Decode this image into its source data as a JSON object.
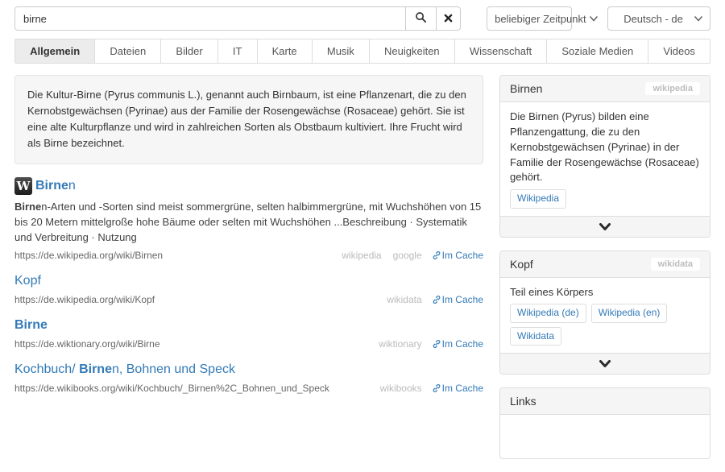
{
  "colors": {
    "accent": "#337ab7",
    "muted_engine_label": "#bbbbbb",
    "panel_header_bg": "#f5f5f5",
    "active_tab_bg": "#ececec",
    "border": "#dddddd"
  },
  "icons": {
    "search": "magnifier-icon",
    "clear": "x-icon",
    "cache": "link-icon",
    "collapse": "chevron-down-icon",
    "select": "chevron-down-icon",
    "result_favicon": "wikipedia-w-icon"
  },
  "search": {
    "query": "birne",
    "time_range": "beliebiger Zeitpunkt",
    "language": "Deutsch - de"
  },
  "tabs": [
    {
      "label": "Allgemein",
      "active": true
    },
    {
      "label": "Dateien",
      "active": false
    },
    {
      "label": "Bilder",
      "active": false
    },
    {
      "label": "IT",
      "active": false
    },
    {
      "label": "Karte",
      "active": false
    },
    {
      "label": "Musik",
      "active": false
    },
    {
      "label": "Neuigkeiten",
      "active": false
    },
    {
      "label": "Wissenschaft",
      "active": false
    },
    {
      "label": "Soziale Medien",
      "active": false
    },
    {
      "label": "Videos",
      "active": false
    }
  ],
  "infobox": {
    "text": "Die Kultur-Birne (Pyrus communis L.), genannt auch Birnbaum, ist eine Pflanzenart, die zu den Kernobstgewächsen (Pyrinae) aus der Familie der Rosengewächse (Rosaceae) gehört. Sie ist eine alte Kulturpflanze und wird in zahlreichen Sorten als Obstbaum kultiviert. Ihre Frucht wird als Birne bezeichnet."
  },
  "results": [
    {
      "favicon": "wikipedia-w",
      "favicon_letter": "W",
      "title": [
        {
          "t": "Birne",
          "b": true
        },
        {
          "t": "n",
          "b": false
        }
      ],
      "description": [
        {
          "t": "Birne",
          "b": true
        },
        {
          "t": "n-Arten und -Sorten sind meist sommergrüne, selten halbimmergrüne, mit Wuchshöhen von 15 bis 20 Metern mittelgroße hohe Bäume oder selten mit Wuchshöhen ...Beschreibung · Systematik und Verbreitung · Nutzung",
          "b": false
        }
      ],
      "url": "https://de.wikipedia.org/wiki/Birnen",
      "engines": [
        "wikipedia",
        "google"
      ],
      "cache_label": "Im Cache"
    },
    {
      "title": [
        {
          "t": "Kopf",
          "b": false
        }
      ],
      "url": "https://de.wikipedia.org/wiki/Kopf",
      "engines": [
        "wikidata"
      ],
      "cache_label": "Im Cache"
    },
    {
      "title": [
        {
          "t": "Birne",
          "b": true
        }
      ],
      "url": "https://de.wiktionary.org/wiki/Birne",
      "engines": [
        "wiktionary"
      ],
      "cache_label": "Im Cache"
    },
    {
      "title": [
        {
          "t": "Kochbuch/ ",
          "b": false
        },
        {
          "t": "Birne",
          "b": true
        },
        {
          "t": "n, Bohnen und Speck",
          "b": false
        }
      ],
      "url": "https://de.wikibooks.org/wiki/Kochbuch/_Birnen%2C_Bohnen_und_Speck",
      "engines": [
        "wikibooks"
      ],
      "cache_label": "Im Cache"
    }
  ],
  "sidebar": {
    "panels": [
      {
        "title": "Birnen",
        "badge": "wikipedia",
        "text": "Die Birnen (Pyrus) bilden eine Pflanzengattung, die zu den Kernobstgewächsen (Pyrinae) in der Familie der Rosengewächse (Rosaceae) gehört.",
        "buttons": [
          "Wikipedia"
        ],
        "collapsible": true
      },
      {
        "title": "Kopf",
        "badge": "wikidata",
        "text": "Teil eines Körpers",
        "buttons": [
          "Wikipedia (de)",
          "Wikipedia (en)",
          "Wikidata"
        ],
        "collapsible": true
      },
      {
        "title": "Links"
      }
    ]
  }
}
